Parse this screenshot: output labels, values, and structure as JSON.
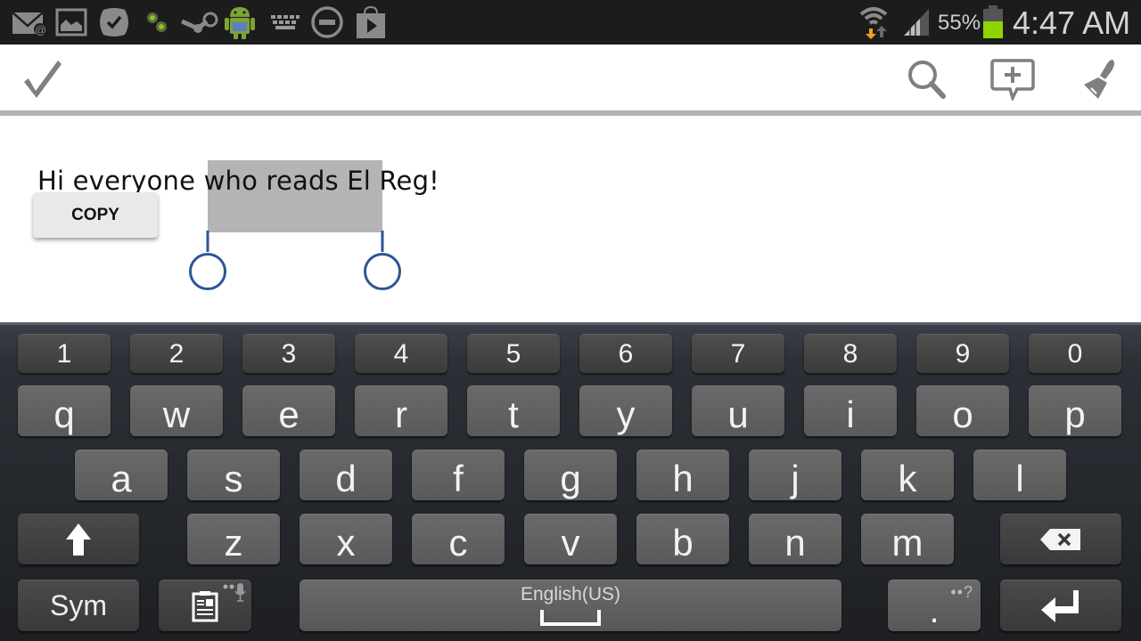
{
  "status_bar": {
    "notification_icons": [
      "email-at-icon",
      "gallery-icon",
      "task-check-icon",
      "link-nodes-icon",
      "steam-icon",
      "android-icon",
      "keyboard-icon",
      "do-not-disturb-icon",
      "play-store-icon"
    ],
    "system_icons": [
      "wifi-icon",
      "signal-icon",
      "battery-icon"
    ],
    "battery_percent": "55%",
    "battery_level": 0.55,
    "battery_color": "#8fd400",
    "time": "4:47 AM"
  },
  "action_bar": {
    "done_icon": "checkmark-icon",
    "actions": [
      "search-icon",
      "add-comment-icon",
      "paintbrush-icon"
    ]
  },
  "editor": {
    "text": "Hi everyone who reads El Reg!",
    "selected_text": "who reads El",
    "copy_label": "COPY",
    "selection_color": "#b4b4b4",
    "handle_color": "#2f5596"
  },
  "keyboard": {
    "number_row": [
      "1",
      "2",
      "3",
      "4",
      "5",
      "6",
      "7",
      "8",
      "9",
      "0"
    ],
    "row1": [
      "q",
      "w",
      "e",
      "r",
      "t",
      "y",
      "u",
      "i",
      "o",
      "p"
    ],
    "row2": [
      "a",
      "s",
      "d",
      "f",
      "g",
      "h",
      "j",
      "k",
      "l"
    ],
    "row3": [
      "z",
      "x",
      "c",
      "v",
      "b",
      "n",
      "m"
    ],
    "shift_icon": "shift-arrow-icon",
    "backspace_icon": "backspace-icon",
    "sym_label": "Sym",
    "clipboard_icon": "clipboard-icon",
    "mic_hint": "mic-icon",
    "space_label": "English(US)",
    "period_label": ".",
    "period_hint": "••?",
    "enter_icon": "enter-icon"
  }
}
